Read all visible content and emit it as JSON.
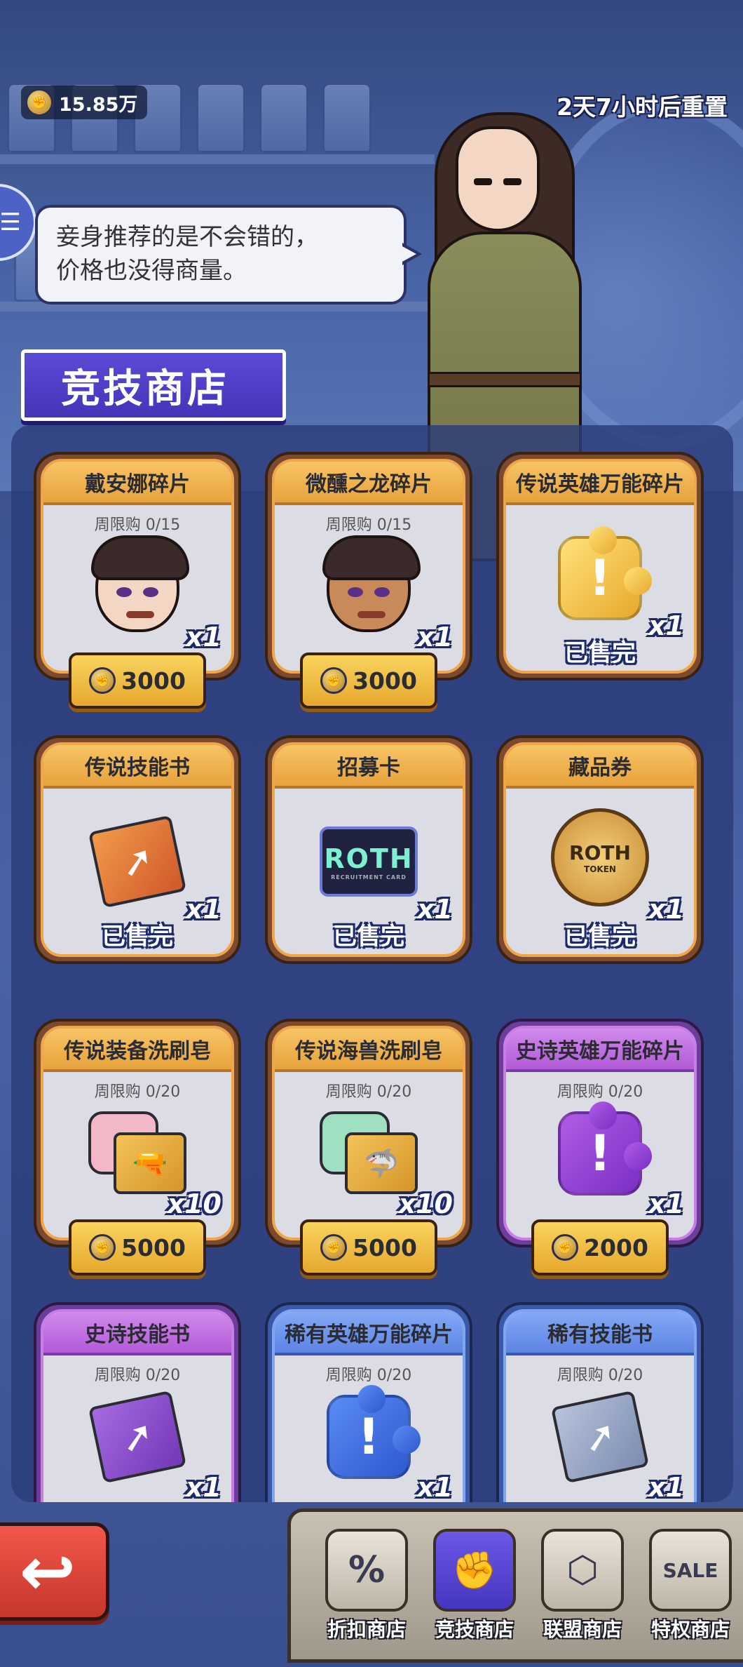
{
  "header": {
    "currency_value": "15.85万",
    "reset_text": "2天7小时后重置"
  },
  "speech": {
    "line1": "妾身推荐的是不会错的，",
    "line2": "价格也没得商量。"
  },
  "shop_title": "竞技商店",
  "items": [
    {
      "name": "戴安娜碎片",
      "limit": "周限购 0/15",
      "qty": "x1",
      "price": "3000",
      "sold_out": "",
      "icon": "hero-shard-diana-icon"
    },
    {
      "name": "微醺之龙碎片",
      "limit": "周限购 0/15",
      "qty": "x1",
      "price": "3000",
      "sold_out": "",
      "icon": "hero-shard-dragon-icon"
    },
    {
      "name": "传说英雄万能碎片",
      "limit": "",
      "qty": "x1",
      "price": "",
      "sold_out": "已售完",
      "icon": "gold-puzzle-icon"
    },
    {
      "name": "传说技能书",
      "limit": "",
      "qty": "x1",
      "price": "",
      "sold_out": "已售完",
      "icon": "orange-skill-book-icon"
    },
    {
      "name": "招募卡",
      "limit": "",
      "qty": "x1",
      "price": "",
      "sold_out": "已售完",
      "icon": "recruitment-card-icon",
      "card_text": "ROTH",
      "card_sub": "RECRUITMENT CARD"
    },
    {
      "name": "藏品券",
      "limit": "",
      "qty": "x1",
      "price": "",
      "sold_out": "已售完",
      "icon": "roth-token-icon",
      "token_text": "ROTH",
      "token_sub": "TOKEN"
    },
    {
      "name": "传说装备洗刷皂",
      "limit": "周限购 0/20",
      "qty": "x10",
      "price": "5000",
      "sold_out": "",
      "icon": "equipment-soap-icon"
    },
    {
      "name": "传说海兽洗刷皂",
      "limit": "周限购 0/20",
      "qty": "x10",
      "price": "5000",
      "sold_out": "",
      "icon": "beast-soap-icon"
    },
    {
      "name": "史诗英雄万能碎片",
      "limit": "周限购 0/20",
      "qty": "x1",
      "price": "2000",
      "sold_out": "",
      "icon": "purple-puzzle-icon"
    },
    {
      "name": "史诗技能书",
      "limit": "周限购 0/20",
      "qty": "x1",
      "price": "",
      "sold_out": "",
      "icon": "purple-skill-book-icon"
    },
    {
      "name": "稀有英雄万能碎片",
      "limit": "周限购 0/20",
      "qty": "x1",
      "price": "",
      "sold_out": "",
      "icon": "blue-puzzle-icon"
    },
    {
      "name": "稀有技能书",
      "limit": "周限购 0/20",
      "qty": "x1",
      "price": "",
      "sold_out": "",
      "icon": "grey-skill-book-icon"
    }
  ],
  "tabs": [
    {
      "label": "折扣商店",
      "icon": "discount-icon",
      "glyph": "%"
    },
    {
      "label": "竞技商店",
      "icon": "fist-icon",
      "glyph": "✊"
    },
    {
      "label": "联盟商店",
      "icon": "alliance-icon",
      "glyph": "⬡"
    },
    {
      "label": "特权商店",
      "icon": "sale-tag-icon",
      "glyph": "SALE"
    }
  ],
  "colors": {
    "accent_purple": "#4d3ec8",
    "price_gold": "#f2c04a",
    "legendary_header": "#f0b24c",
    "epic_header": "#c275e4",
    "rare_header": "#6f96ee"
  }
}
